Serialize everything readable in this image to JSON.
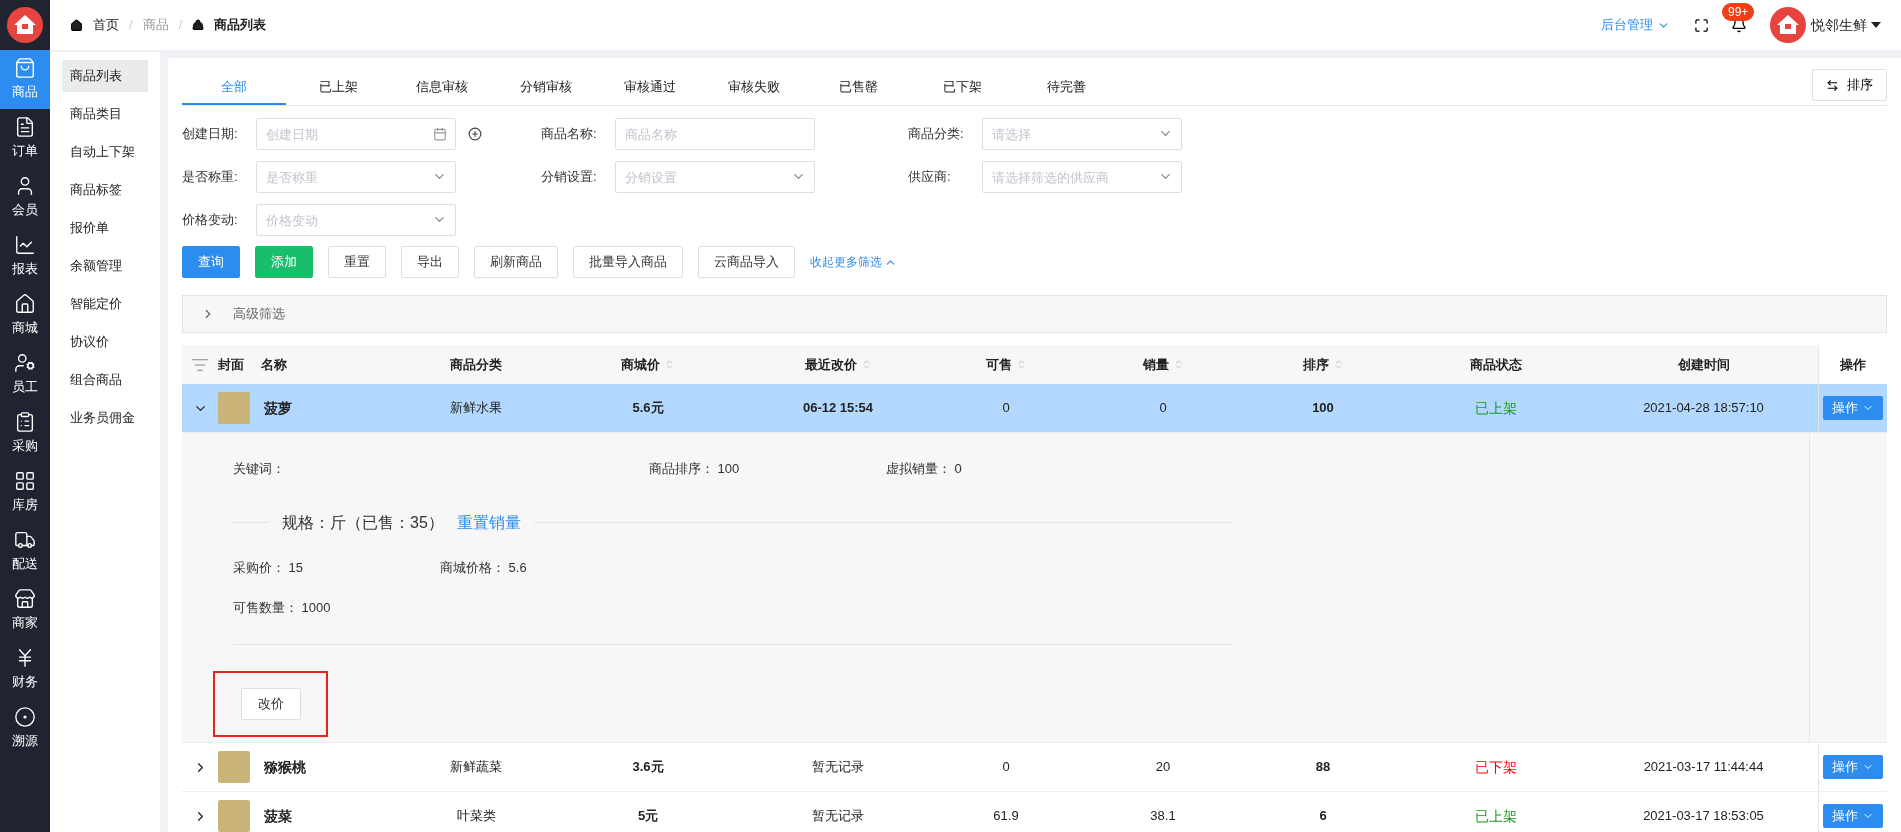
{
  "header": {
    "breadcrumb": [
      {
        "label": "首页",
        "kind": "home"
      },
      {
        "separator": "/",
        "label": "商品",
        "kind": "plain"
      },
      {
        "separator": "/",
        "label": "商品列表",
        "kind": "current"
      }
    ],
    "admin_menu": "后台管理",
    "notification_badge": "99+",
    "user_name": "悦邻生鲜"
  },
  "rail": [
    {
      "label": "商品",
      "selected": true
    },
    {
      "label": "订单",
      "selected": false
    },
    {
      "label": "会员",
      "selected": false
    },
    {
      "label": "报表",
      "selected": false
    },
    {
      "label": "商城",
      "selected": false
    },
    {
      "label": "员工",
      "selected": false
    },
    {
      "label": "采购",
      "selected": false
    },
    {
      "label": "库房",
      "selected": false
    },
    {
      "label": "配送",
      "selected": false
    },
    {
      "label": "商家",
      "selected": false
    },
    {
      "label": "财务",
      "selected": false
    },
    {
      "label": "溯源",
      "selected": false
    }
  ],
  "submenu": [
    {
      "label": "商品列表",
      "selected": true
    },
    {
      "label": "商品类目",
      "selected": false
    },
    {
      "label": "自动上下架",
      "selected": false
    },
    {
      "label": "商品标签",
      "selected": false
    },
    {
      "label": "报价单",
      "selected": false
    },
    {
      "label": "余额管理",
      "selected": false
    },
    {
      "label": "智能定价",
      "selected": false
    },
    {
      "label": "协议价",
      "selected": false
    },
    {
      "label": "组合商品",
      "selected": false
    },
    {
      "label": "业务员佣金",
      "selected": false
    }
  ],
  "tabs": [
    {
      "label": "全部",
      "selected": true
    },
    {
      "label": "已上架",
      "selected": false
    },
    {
      "label": "信息审核",
      "selected": false
    },
    {
      "label": "分销审核",
      "selected": false
    },
    {
      "label": "审核通过",
      "selected": false
    },
    {
      "label": "审核失败",
      "selected": false
    },
    {
      "label": "已售罄",
      "selected": false
    },
    {
      "label": "已下架",
      "selected": false
    },
    {
      "label": "待完善",
      "selected": false
    }
  ],
  "sort_button": "排序",
  "filters": [
    {
      "label": "创建日期:",
      "placeholder": "创建日期",
      "kind": "date"
    },
    {
      "label": "商品名称:",
      "placeholder": "商品名称",
      "kind": "text"
    },
    {
      "label": "商品分类:",
      "placeholder": "请选择",
      "kind": "select"
    },
    {
      "label": "是否称重:",
      "placeholder": "是否称重",
      "kind": "select"
    },
    {
      "label": "分销设置:",
      "placeholder": "分销设置",
      "kind": "select"
    },
    {
      "label": "供应商:",
      "placeholder": "请选择筛选的供应商",
      "kind": "select"
    },
    {
      "label": "价格变动:",
      "placeholder": "价格变动",
      "kind": "select"
    }
  ],
  "actions": [
    {
      "label": "查询",
      "kind": "primary"
    },
    {
      "label": "添加",
      "kind": "success"
    },
    {
      "label": "重置",
      "kind": "default"
    },
    {
      "label": "导出",
      "kind": "default"
    },
    {
      "label": "刷新商品",
      "kind": "default"
    },
    {
      "label": "批量导入商品",
      "kind": "default"
    },
    {
      "label": "云商品导入",
      "kind": "default"
    }
  ],
  "collapse_link": "收起更多筛选",
  "advanced_filter": {
    "label": "高级筛选",
    "expanded": false
  },
  "table": {
    "columns": [
      {
        "label": "封面",
        "sortable": false
      },
      {
        "label": "名称",
        "sortable": false
      },
      {
        "label": "商品分类",
        "sortable": false
      },
      {
        "label": "商城价",
        "sortable": true
      },
      {
        "label": "最近改价",
        "sortable": true
      },
      {
        "label": "可售",
        "sortable": true
      },
      {
        "label": "销量",
        "sortable": true
      },
      {
        "label": "排序",
        "sortable": true
      },
      {
        "label": "商品状态",
        "sortable": false
      },
      {
        "label": "创建时间",
        "sortable": false
      },
      {
        "label": "操作",
        "sortable": false
      }
    ],
    "rows": [
      {
        "name": "菠萝",
        "category": "新鲜水果",
        "price": "5.6元",
        "last_change": "06-12 15:54",
        "available": "0",
        "sales": "0",
        "sort": "100",
        "status": {
          "label": "已上架",
          "color": "#1a9a1a"
        },
        "created": "2021-04-28 18:57:10",
        "action": "操作",
        "expanded": true,
        "selected": true,
        "detail": {
          "fields": [
            {
              "label": "关键词："
            },
            {
              "label": "商品排序：",
              "value": "100"
            },
            {
              "label": "虚拟销量：",
              "value": "0"
            }
          ],
          "spec_title": "规格：斤（已售：35）",
          "spec_link": "重置销量",
          "spec_fields": [
            {
              "label": "采购价：",
              "value": "15"
            },
            {
              "label": "商城价格：",
              "value": "5.6"
            },
            {
              "label": "可售数量：",
              "value": "1000"
            }
          ],
          "button": "改价",
          "button_highlighted": true
        }
      },
      {
        "name": "猕猴桃",
        "category": "新鲜蔬菜",
        "price": "3.6元",
        "last_change": "暂无记录",
        "available": "0",
        "sales": "20",
        "sort": "88",
        "status": {
          "label": "已下架",
          "color": "#ff0000"
        },
        "created": "2021-03-17 11:44:44",
        "action": "操作",
        "expanded": false,
        "selected": false
      },
      {
        "name": "菠菜",
        "category": "叶菜类",
        "price": "5元",
        "last_change": "暂无记录",
        "available": "61.9",
        "sales": "38.1",
        "sort": "6",
        "status": {
          "label": "已上架",
          "color": "#1a9a1a"
        },
        "created": "2021-03-17 18:53:05",
        "action": "操作",
        "expanded": false,
        "selected": false
      }
    ]
  }
}
